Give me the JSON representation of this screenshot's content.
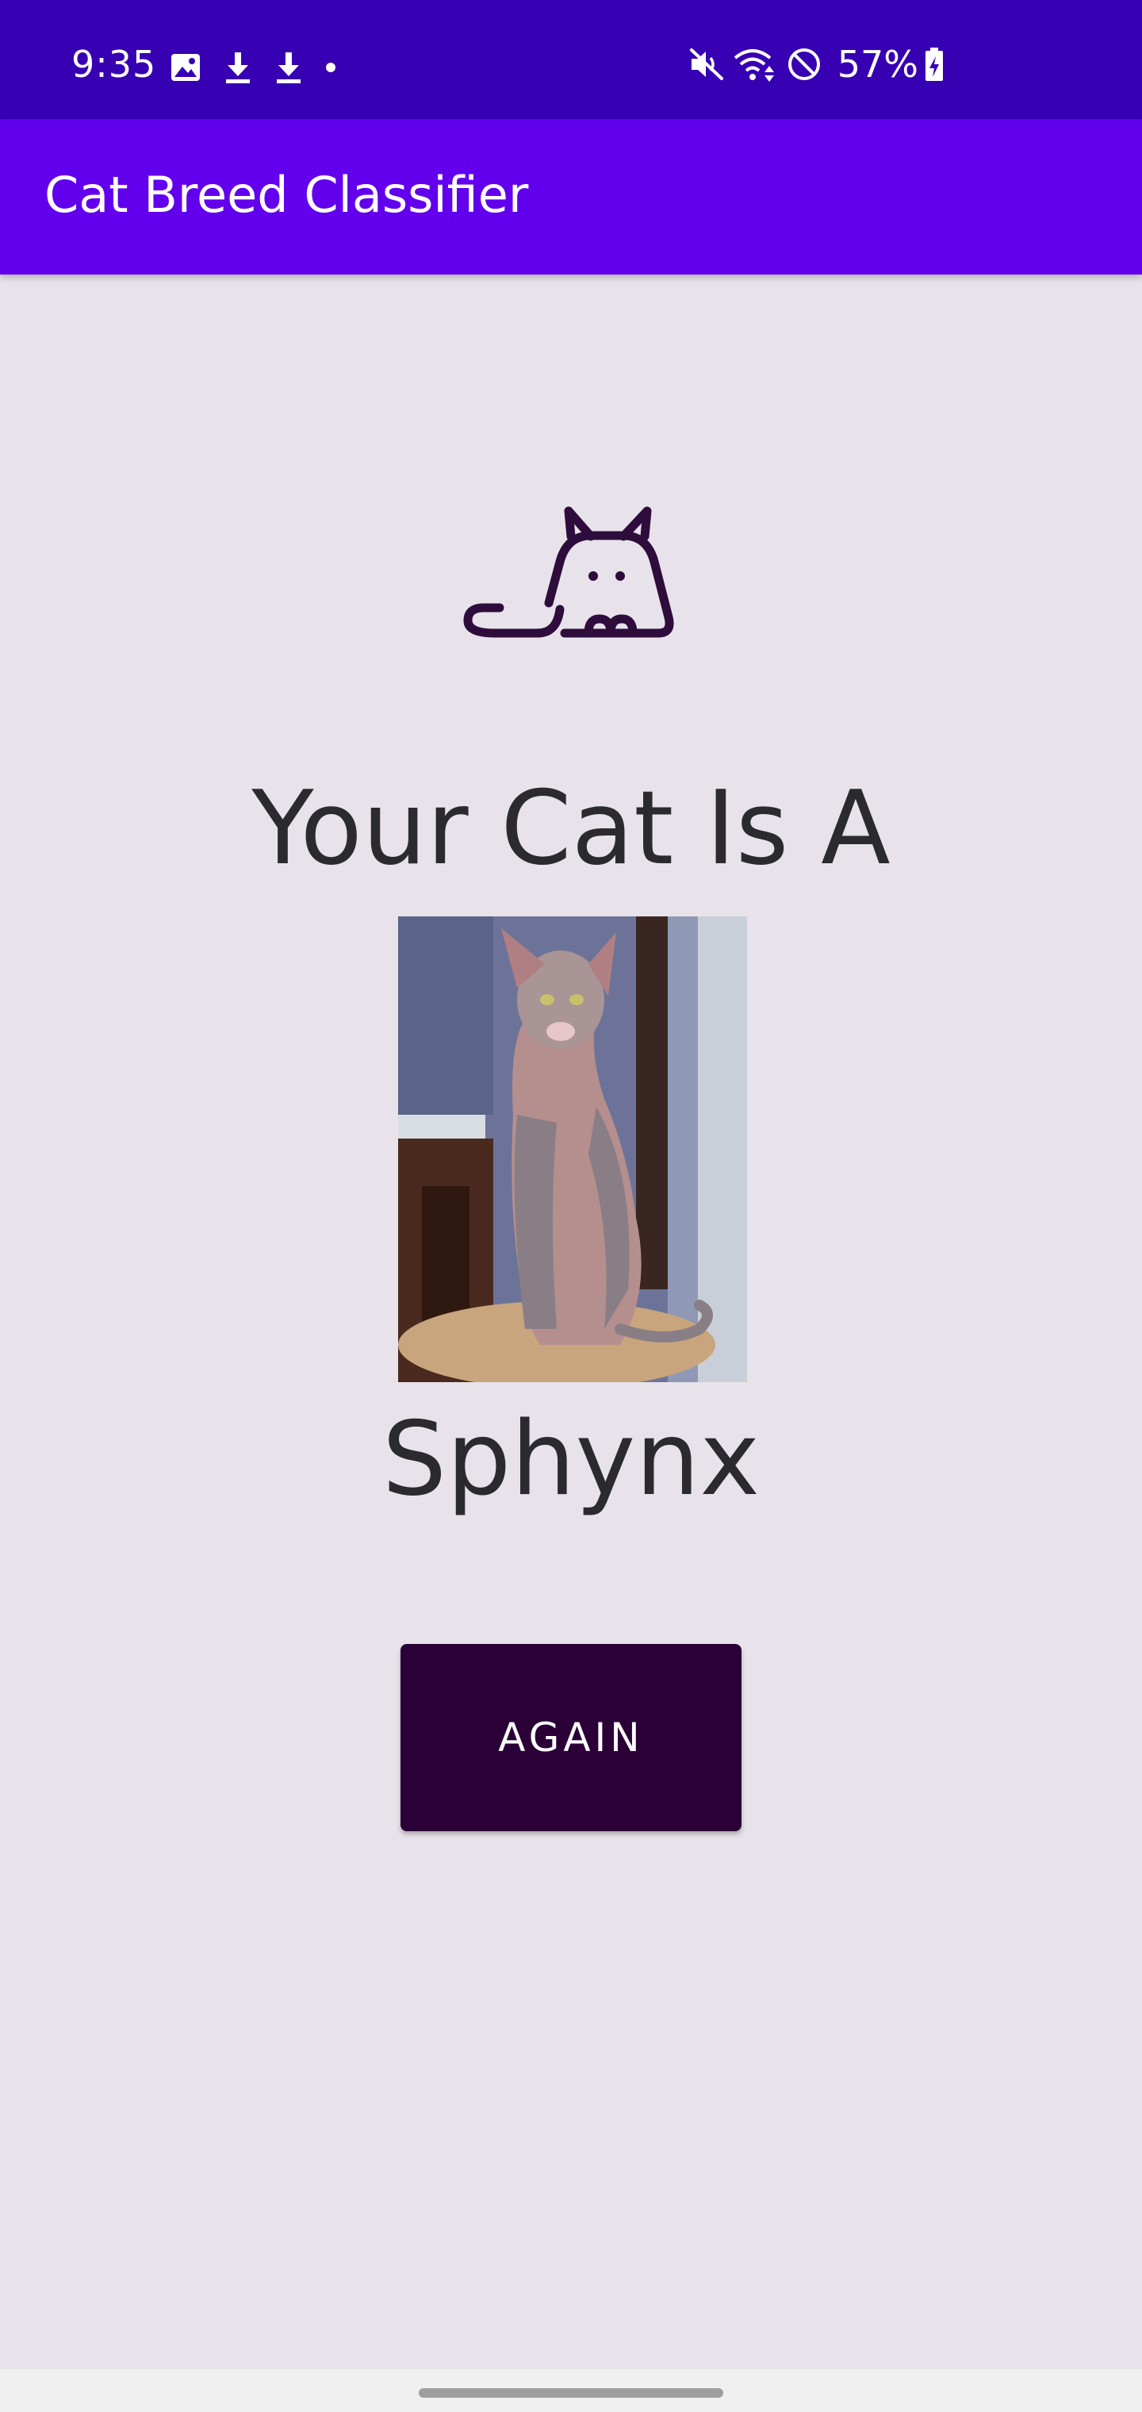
{
  "status_bar": {
    "time": "9:35",
    "left_icons": [
      "image-icon",
      "download-icon",
      "download-icon",
      "dot-icon"
    ],
    "right_icons": [
      "mute-icon",
      "wifi-icon",
      "do-not-disturb-icon",
      "battery-charging-icon"
    ],
    "battery": "57%"
  },
  "app_bar": {
    "title": "Cat Breed Classifier"
  },
  "main": {
    "logo_icon": "cat-icon",
    "headline": "Your Cat Is A",
    "breed": "Sphynx",
    "again_label": "AGAIN"
  },
  "colors": {
    "status_bar": "#3700b3",
    "app_bar": "#6200ee",
    "background": "#e8e3ea",
    "button": "#2a0036",
    "text": "#2b2b2f"
  }
}
